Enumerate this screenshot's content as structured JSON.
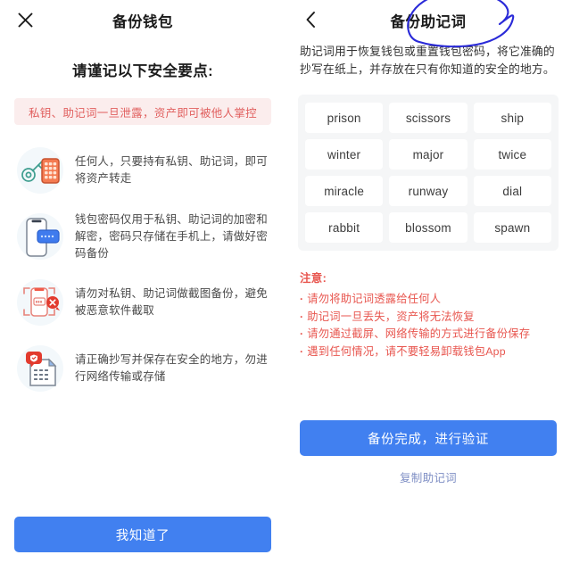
{
  "colors": {
    "primary_blue": "#4180F0",
    "alert_pink_bg": "#FBEDED",
    "alert_red_text": "#E1605F",
    "note_red": "#E8564F",
    "chip_bg": "#FFFFFF",
    "chip_group_bg": "#F5F6F7",
    "link_blue": "#7E8EC4",
    "annotation_blue": "#2A2AD8"
  },
  "left_panel": {
    "close_icon": "close-icon",
    "title": "备份钱包",
    "heading": "请谨记以下安全要点:",
    "alert": "私钥、助记词一旦泄露，资产即可被他人掌控",
    "tips": [
      {
        "icon": "key-keypad-icon",
        "text": "任何人，只要持有私钥、助记词，即可将资产转走"
      },
      {
        "icon": "phone-password-icon",
        "text": "钱包密码仅用于私钥、助记词的加密和解密，密码只存储在手机上，请做好密码备份"
      },
      {
        "icon": "no-screenshot-icon",
        "text": "请勿对私钥、助记词做截图备份，避免被恶意软件截取"
      },
      {
        "icon": "secure-document-icon",
        "text": "请正确抄写并保存在安全的地方，勿进行网络传输或存储"
      }
    ],
    "footer_button": "我知道了"
  },
  "right_panel": {
    "back_icon": "chevron-left-icon",
    "title": "备份助记词",
    "description": "助记词用于恢复钱包或重置钱包密码，将它准确的抄写在纸上，并存放在只有你知道的安全的地方。",
    "mnemonic_words": [
      "prison",
      "scissors",
      "ship",
      "winter",
      "major",
      "twice",
      "miracle",
      "runway",
      "dial",
      "rabbit",
      "blossom",
      "spawn"
    ],
    "notes_title": "注意:",
    "notes": [
      "请勿将助记词透露给任何人",
      "助记词一旦丢失，资产将无法恢复",
      "请勿通过截屏、网络传输的方式进行备份保存",
      "遇到任何情况，请不要轻易卸载钱包App"
    ],
    "primary_button": "备份完成，进行验证",
    "secondary_link": "复制助记词"
  },
  "annotation": {
    "name": "handdrawn-circle-around-title"
  }
}
